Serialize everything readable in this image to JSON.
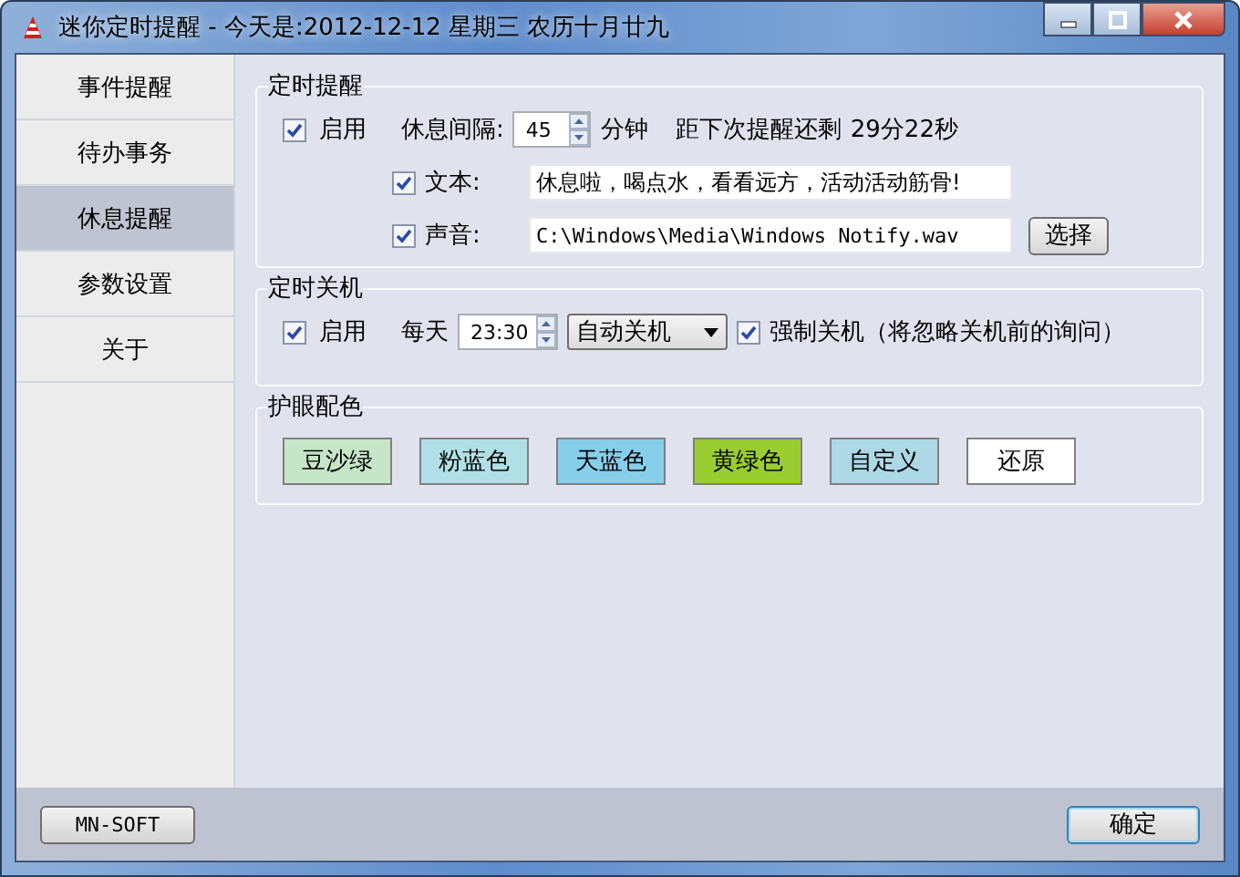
{
  "window": {
    "title": "迷你定时提醒 - 今天是:2012-12-12 星期三 农历十月廿九"
  },
  "sidebar": {
    "items": [
      {
        "label": "事件提醒",
        "selected": false
      },
      {
        "label": "待办事务",
        "selected": false
      },
      {
        "label": "休息提醒",
        "selected": true
      },
      {
        "label": "参数设置",
        "selected": false
      },
      {
        "label": "关于",
        "selected": false
      }
    ]
  },
  "reminder": {
    "title": "定时提醒",
    "enabled": {
      "label": "启用",
      "checked": true
    },
    "interval_label": "休息间隔:",
    "interval": "45",
    "unit": "分钟",
    "countdown_label": "距下次提醒还剩",
    "countdown": "29分22秒",
    "text_option": {
      "label": "文本:",
      "checked": true,
      "value": "休息啦，喝点水，看看远方，活动活动筋骨!"
    },
    "sound_option": {
      "label": "声音:",
      "checked": true,
      "value": "C:\\Windows\\Media\\Windows Notify.wav",
      "button": "选择"
    }
  },
  "shutdown": {
    "title": "定时关机",
    "enabled": {
      "label": "启用",
      "checked": true
    },
    "daily_label": "每天",
    "time": "23:30",
    "mode": "自动关机",
    "force": {
      "label": "强制关机（将忽略关机前的询问）",
      "checked": true
    }
  },
  "eye_colors": {
    "title": "护眼配色",
    "swatches": [
      {
        "label": "豆沙绿",
        "color": "#c7e6c9"
      },
      {
        "label": "粉蓝色",
        "color": "#b0e0e6"
      },
      {
        "label": "天蓝色",
        "color": "#87ceeb"
      },
      {
        "label": "黄绿色",
        "color": "#9acd32"
      },
      {
        "label": "自定义",
        "color": "#add8e6"
      },
      {
        "label": "还原",
        "color": "#ffffff"
      }
    ]
  },
  "footer": {
    "brand_button": "MN-SOFT",
    "ok_button": "确定"
  }
}
